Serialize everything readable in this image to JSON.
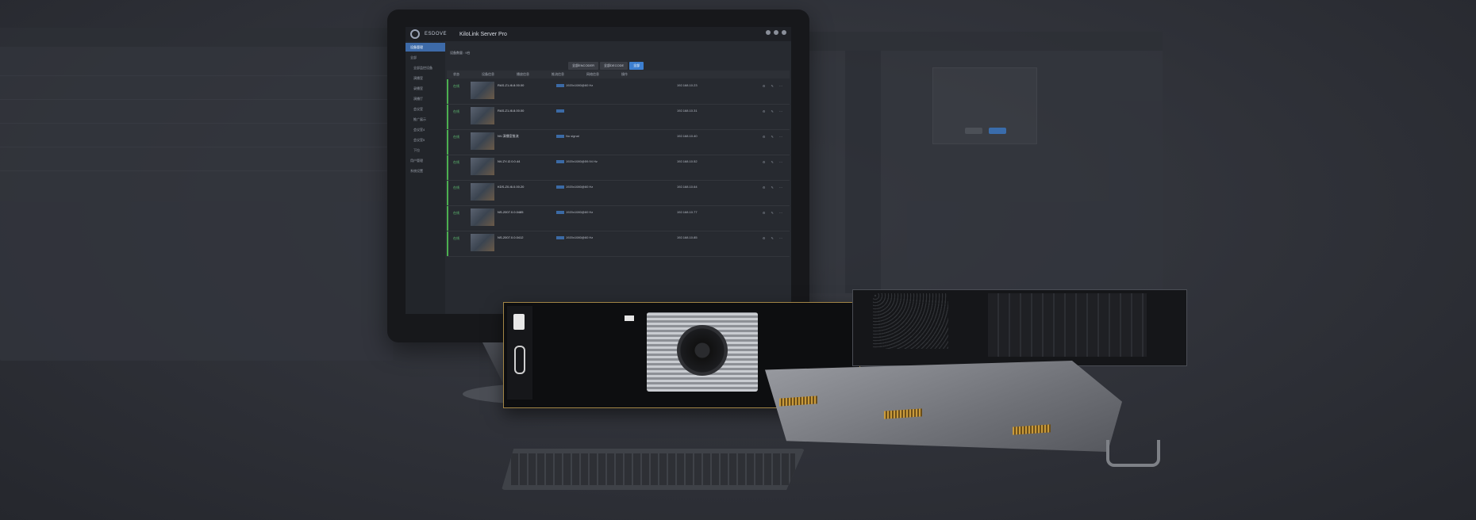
{
  "scene": {
    "background_color": "#2e3037"
  },
  "monitor_app": {
    "brand": "ESDOVE",
    "title": "KiloLink Server Pro",
    "filter_label": "设备数量 : 9台",
    "tabs": [
      "全部ENCODER",
      "全部DECODE",
      "全部"
    ],
    "active_tab_index": 2,
    "sidebar_items": [
      "设备管理",
      "全部",
      "全部监控设备",
      "演播室",
      "录播室",
      "演播厅",
      "会议室",
      "推广展示",
      "会议室4",
      "会议室5",
      "下拉",
      "用户管理",
      "系统设置"
    ],
    "active_sidebar_index": 0,
    "table_headers": [
      "状态",
      "设备信息",
      "播放信息",
      "推流信息",
      "网络信息",
      "操作"
    ],
    "rows": [
      {
        "status": "在线",
        "name": "RAS-Z1-I6.8.00.00",
        "meta": "1920x1080@60 Hz",
        "ip": "192.168.10.23"
      },
      {
        "status": "在线",
        "name": "RAS-Z1-I6.8.00.00",
        "meta": "",
        "ip": "192.168.10.31"
      },
      {
        "status": "在线",
        "name": "NV-演播室推流",
        "meta": "No signal",
        "ip": "192.168.10.40"
      },
      {
        "status": "在线",
        "name": "NV-ZY-I2.0.0.44",
        "meta": "1920x1080@59.94 Hz",
        "ip": "192.168.10.52"
      },
      {
        "status": "在线",
        "name": "KDS-Z0-I6.0.00.20",
        "meta": "1920x1080@60 Hz",
        "ip": "192.168.10.64"
      },
      {
        "status": "在线",
        "name": "NS-2007.0.0.0485",
        "meta": "1920x1080@60 Hz",
        "ip": "192.168.10.77"
      },
      {
        "status": "在线",
        "name": "NS-2007.0.0.0412",
        "meta": "1920x1080@60 Hz",
        "ip": "192.168.10.85"
      }
    ],
    "colors": {
      "accent": "#3d7fd0",
      "online": "#5fbf72"
    }
  },
  "hardware": {
    "capture_card": "PCIe capture card with fan heatsink",
    "chassis": "Open rack-mount server chassis"
  }
}
